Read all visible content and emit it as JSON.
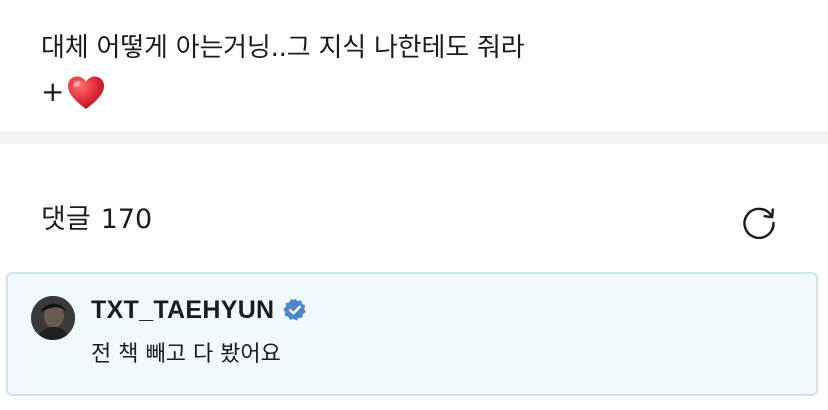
{
  "post": {
    "text": "대체 어떻게 아는거닝..그 지식 나한테도 줘라",
    "reaction_prefix": "+",
    "reaction_icon": "red-heart-icon"
  },
  "comments": {
    "label": "댓글",
    "count": "170",
    "refresh_icon": "refresh-icon"
  },
  "pinned_comment": {
    "author": "TXT_TAEHYUN",
    "verified_icon": "verified-badge-icon",
    "text": "전 책 빼고 다 봤어요"
  },
  "colors": {
    "verified": "#4a88c7",
    "heart": "#e02b3c",
    "card_background": "#f1f9fd",
    "card_border": "#cfe3ec",
    "divider": "#f2f2f4"
  }
}
